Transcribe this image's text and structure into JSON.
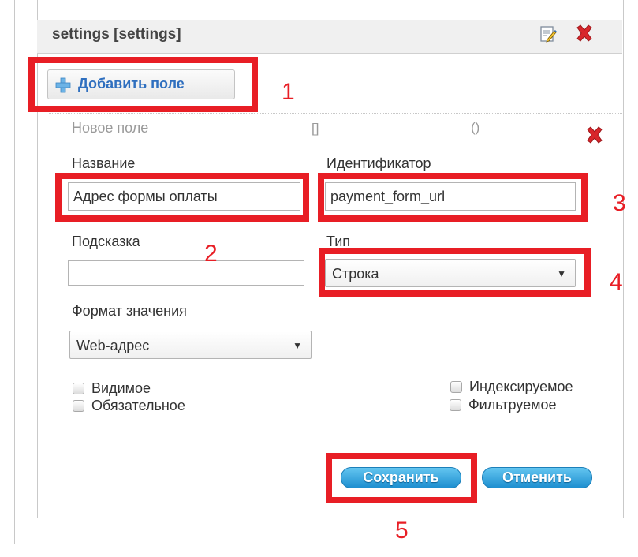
{
  "panel": {
    "title": "settings [settings]"
  },
  "toolbar": {
    "add_field_label": "Добавить поле"
  },
  "new_field": {
    "name": "Новое поле",
    "brackets": "[]",
    "parens": "()"
  },
  "form": {
    "name_label": "Название",
    "name_value": "Адрес формы оплаты",
    "identifier_label": "Идентификатор",
    "identifier_value": "payment_form_url",
    "hint_label": "Подсказка",
    "hint_value": "",
    "type_label": "Тип",
    "type_value": "Строка",
    "format_label": "Формат значения",
    "format_value": "Web-адрес",
    "checkboxes": {
      "visible": "Видимое",
      "indexed": "Индексируемое",
      "required": "Обязательное",
      "filterable": "Фильтруемое"
    },
    "save_label": "Сохранить",
    "cancel_label": "Отменить"
  },
  "annotations": [
    "1",
    "2",
    "3",
    "4",
    "5"
  ],
  "colors": {
    "annotation_red": "#e81e25",
    "button_blue": "#1e8fd0",
    "link_blue": "#2f6fbf"
  },
  "icons": {
    "edit": "edit-icon",
    "close": "close-icon",
    "plus": "plus-icon"
  }
}
